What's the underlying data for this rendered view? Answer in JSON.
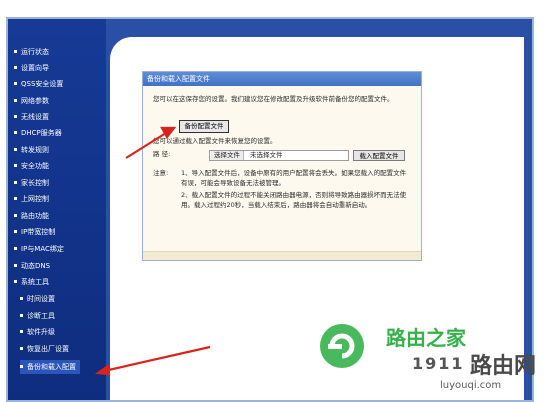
{
  "sidebar": {
    "items": [
      {
        "label": "运行状态"
      },
      {
        "label": "设置向导"
      },
      {
        "label": "QSS安全设置"
      },
      {
        "label": "网络参数"
      },
      {
        "label": "无线设置"
      },
      {
        "label": "DHCP服务器"
      },
      {
        "label": "转发规则"
      },
      {
        "label": "安全功能"
      },
      {
        "label": "家长控制"
      },
      {
        "label": "上网控制"
      },
      {
        "label": "路由功能"
      },
      {
        "label": "IP带宽控制"
      },
      {
        "label": "IP与MAC绑定"
      },
      {
        "label": "动态DNS"
      },
      {
        "label": "系统工具"
      }
    ],
    "subitems": [
      {
        "label": "时间设置"
      },
      {
        "label": "诊断工具"
      },
      {
        "label": "软件升级"
      },
      {
        "label": "恢复出厂设置"
      },
      {
        "label": "备份和载入配置"
      }
    ]
  },
  "panel": {
    "title": "备份和载入配置文件",
    "intro": "您可以在这保存您的设置。我们建议您在修改配置及升级软件前备份您的配置文件。",
    "backup_button": "备份配置文件",
    "load_hint": "您可以通过载入配置文件来恢复您的设置。",
    "path_label": "路 径:",
    "choose_file": "选择文件",
    "file_status": "未选择文件",
    "load_button": "载入配置文件",
    "note_label": "注意:",
    "note_1": "1、导入配置文件后，设备中原有的用户配置将会丢失。如果您载入的配置文件有误，可能会导致设备无法被管理。",
    "note_2": "2、载入配置文件的过程不能关闭路由器电源，否则将导致路由器损坏而无法使用。载入过程约20秒，当载入结束后，路由器将会自动重新启动。"
  },
  "watermark": {
    "brand_cn": "路由之家",
    "brand_cn_2": "路由网",
    "num": "1911",
    "url": "luyouqi.com"
  },
  "colors": {
    "sidebar_bg": "#163a96",
    "panel_title": "#4f80cf",
    "arrow": "#d8241c",
    "watermark_green": "#34b14a"
  }
}
